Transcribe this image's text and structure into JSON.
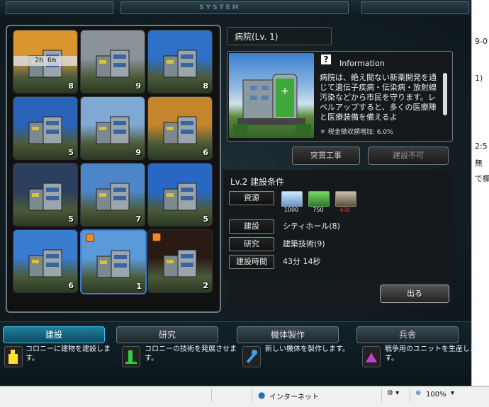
{
  "topbar": {
    "emblem": "SYSTEM"
  },
  "right_strip": {
    "lines": [
      "9-0",
      "1)",
      "2:5",
      "無",
      "で欄"
    ]
  },
  "grid": {
    "tiles": [
      {
        "count": "8",
        "timer": "2h 6m",
        "sky": "#d9962e",
        "flag": false
      },
      {
        "count": "9",
        "timer": "",
        "sky": "#8a939a",
        "flag": false
      },
      {
        "count": "8",
        "timer": "",
        "sky": "#2f71c9",
        "flag": false
      },
      {
        "count": "5",
        "timer": "",
        "sky": "#2a63b8",
        "flag": false
      },
      {
        "count": "9",
        "timer": "",
        "sky": "#7fa9d4",
        "flag": false
      },
      {
        "count": "6",
        "timer": "",
        "sky": "#c4852c",
        "flag": false
      },
      {
        "count": "5",
        "timer": "",
        "sky": "#2d3f5f",
        "flag": false
      },
      {
        "count": "7",
        "timer": "",
        "sky": "#4c86c8",
        "flag": false
      },
      {
        "count": "5",
        "timer": "",
        "sky": "#2a67c4",
        "flag": false
      },
      {
        "count": "6",
        "timer": "",
        "sky": "#3a7cd0",
        "flag": false
      },
      {
        "count": "1",
        "timer": "",
        "sky": "#5a9ad8",
        "flag": true
      },
      {
        "count": "2",
        "timer": "",
        "sky": "#2a1a14",
        "flag": true
      }
    ]
  },
  "detail": {
    "title": "病院(Lv. 1)",
    "info_heading": "Information",
    "info_text": "病院は、絶え間ない新薬開発を通じて遺伝子疾病・伝染病・放射線汚染などから市民を守ります。レベルアップすると、多くの医療陣と医療装備を備えるよ",
    "info_note": "＊ 税金徴収額増加: 6.0%",
    "rush_button": "突貫工事",
    "cannot_button": "建設不可",
    "req_title": "Lv.2 建設条件",
    "req_labels": {
      "resource": "資源",
      "build": "建設",
      "research": "研究",
      "time": "建設時間"
    },
    "resources": [
      {
        "amount": "1000",
        "color": "#ffffff"
      },
      {
        "amount": "750",
        "color": "#ffffff"
      },
      {
        "amount": "400",
        "color": "#ff3030"
      }
    ],
    "req_build": "シティホール(8)",
    "req_research": "建築技術(9)",
    "req_time": "43分 14秒",
    "exit_button": "出る"
  },
  "menu": {
    "tabs": [
      {
        "label": "建設",
        "desc": "コロニーに建物を建設します。"
      },
      {
        "label": "研究",
        "desc": "コロニーの技術を発展させます。"
      },
      {
        "label": "機体製作",
        "desc": "新しい機体を製作します。"
      },
      {
        "label": "兵舎",
        "desc": "戦争用のユニットを生産します。"
      }
    ]
  },
  "status": {
    "zone": "インターネット",
    "zoom": "100%"
  },
  "colors": {
    "accent": "#1f7fa0",
    "deficit": "#ff3030"
  }
}
